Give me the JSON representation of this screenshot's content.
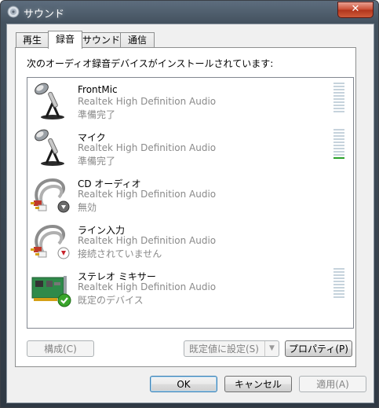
{
  "window": {
    "title": "サウンド",
    "close_label": "✕"
  },
  "tabs": [
    {
      "label": "再生",
      "active": false
    },
    {
      "label": "録音",
      "active": true
    },
    {
      "label": "サウンド",
      "active": false
    },
    {
      "label": "通信",
      "active": false
    }
  ],
  "panel": {
    "description": "次のオーディオ録音デバイスがインストールされています:"
  },
  "devices": [
    {
      "name": "FrontMic",
      "driver": "Realtek High Definition Audio",
      "status": "準備完了",
      "icon": "microphone-icon",
      "badge": "",
      "meter": true,
      "level": 0
    },
    {
      "name": "マイク",
      "driver": "Realtek High Definition Audio",
      "status": "準備完了",
      "icon": "microphone-icon",
      "badge": "",
      "meter": true,
      "level": 0.1
    },
    {
      "name": "CD オーディオ",
      "driver": "Realtek High Definition Audio",
      "status": "無効",
      "icon": "rca-cable-icon",
      "badge": "disabled-down-arrow-icon",
      "meter": false
    },
    {
      "name": "ライン入力",
      "driver": "Realtek High Definition Audio",
      "status": "接続されていません",
      "icon": "rca-cable-icon",
      "badge": "unplugged-red-arrow-icon",
      "meter": false
    },
    {
      "name": "ステレオ ミキサー",
      "driver": "Realtek High Definition Audio",
      "status": "既定のデバイス",
      "icon": "sound-card-icon",
      "badge": "default-check-icon",
      "meter": true,
      "level": 0
    }
  ],
  "buttons": {
    "configure": "構成(C)",
    "set_default": "既定値に設定(S)",
    "properties": "プロパティ(P)",
    "ok": "OK",
    "cancel": "キャンセル",
    "apply": "適用(A)"
  },
  "colors": {
    "meter_active": "#2aa12a",
    "meter_idle": "#c6d3dc",
    "badge_check": "#3aa52c",
    "badge_red": "#c8242b"
  }
}
